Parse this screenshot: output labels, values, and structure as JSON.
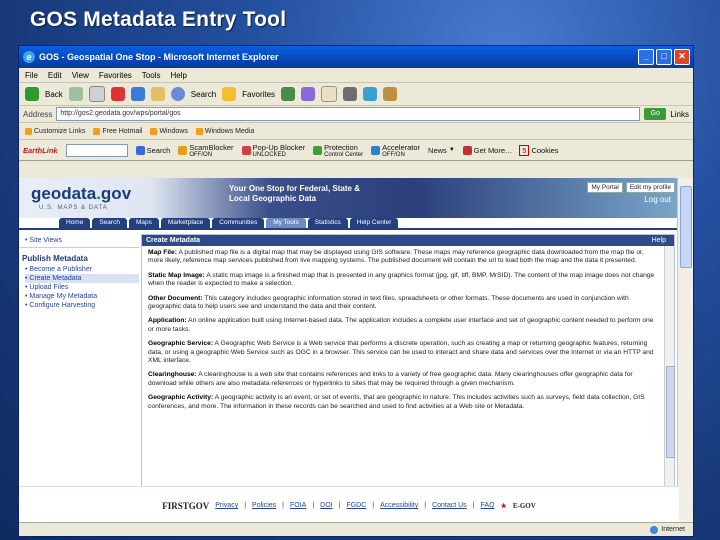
{
  "slide": {
    "title": "GOS Metadata Entry Tool"
  },
  "window": {
    "title": "GOS - Geospatial One Stop - Microsoft Internet Explorer",
    "controls": {
      "minimize": "_",
      "maximize": "□",
      "close": "✕"
    }
  },
  "menubar": [
    "File",
    "Edit",
    "View",
    "Favorites",
    "Tools",
    "Help"
  ],
  "toolbar": {
    "back": "Back",
    "search": "Search",
    "favorites": "Favorites"
  },
  "address": {
    "label": "Address",
    "url": "http://gos2.geodata.gov/wps/portal/gos",
    "go": "Go",
    "links": "Links"
  },
  "linksbar": [
    "Customize Links",
    "Free Hotmail",
    "Windows",
    "Windows Media"
  ],
  "earthlink": {
    "logo": "EarthLink",
    "items": [
      {
        "label": "Search"
      },
      {
        "label": "ScamBlocker",
        "sub": "OFF/ON"
      },
      {
        "label": "Pop-Up Blocker",
        "sub": "UNLOCKED"
      },
      {
        "label": "Protection",
        "sub": "Control Center"
      },
      {
        "label": "Accelerator",
        "sub": "OFF/ON"
      },
      {
        "label": "News"
      },
      {
        "label": "Get More..."
      },
      {
        "label": "Cookies",
        "sub": ""
      }
    ],
    "count": "5"
  },
  "site": {
    "logo_main": "geodata",
    "logo_dot": ".",
    "logo_gov": "gov",
    "logo_sub": "U.S. MAPS & DATA",
    "tagline": "Your One Stop for Federal, State & Local Geographic Data",
    "portal_links": [
      "My Portal",
      "Edit my profile"
    ],
    "logout": "Log out",
    "tabs": [
      "Home",
      "Search",
      "Maps",
      "Marketplace",
      "Communities",
      "My Tools",
      "Statistics",
      "Help Center"
    ],
    "active_tab": "My Tools",
    "leftnav": {
      "top": "• Site Views",
      "section": "Publish Metadata",
      "items": [
        "• Become a Publisher",
        "• Create Metadata",
        "• Upload Files",
        "• Manage My Metadata",
        "• Configure Harvesting"
      ]
    },
    "panel": {
      "title": "Create Metadata",
      "help": "Help",
      "entries": [
        {
          "term": "Map File:",
          "text": "A published map file is a digital map that may be displayed using GIS software. These maps may reference geographic data downloaded from the map file or, more likely, reference map services published from live mapping systems. The published document will contain the url to load both the map and the data it presented."
        },
        {
          "term": "Static Map Image:",
          "text": "A static map image is a finished map that is presented in any graphics format (jpg, gif, tiff, BMP, MrSID). The content of the map image does not change when the reader is expected to make a selection."
        },
        {
          "term": "Other Document:",
          "text": "This category includes geographic information stored in text files, spreadsheets or other formats. These documents are used in conjunction with geographic data to help users see and understand the data and their content."
        },
        {
          "term": "Application:",
          "text": "An online application built using Internet-based data. The application includes a complete user interface and set of geographic content needed to perform one or more tasks."
        },
        {
          "term": "Geographic Service:",
          "text": "A Geographic Web Service is a Web service that performs a discrete operation, such as creating a map or returning geographic features, returning data, or using a geographic Web Service such as OGC in a browser. This service can be used to interact and share data and services over the Internet or via an HTTP and XML interface."
        },
        {
          "term": "Clearinghouse:",
          "text": "A clearinghouse is a web site that contains references and links to a variety of free geographic data. Many clearinghouses offer geographic data for download while others are also metadata references or hyperlinks to sites that may be required through a given mechanism."
        },
        {
          "term": "Geographic Activity:",
          "text": "A geographic activity is an event, or set of events, that are geographic in nature. This includes activities such as surveys, field data collection, GIS conferences, and more. The information in these records can be searched and used to find activities at a Web site or Metadata."
        }
      ]
    },
    "footer": {
      "logo": "FIRSTGOV",
      "links": [
        "Privacy",
        "Policies",
        "FOIA",
        "DOI",
        "FGDC",
        "Accessibility",
        "Contact Us",
        "FAQ"
      ],
      "egov": "E-GOV"
    }
  },
  "status": {
    "zone": "Internet"
  }
}
